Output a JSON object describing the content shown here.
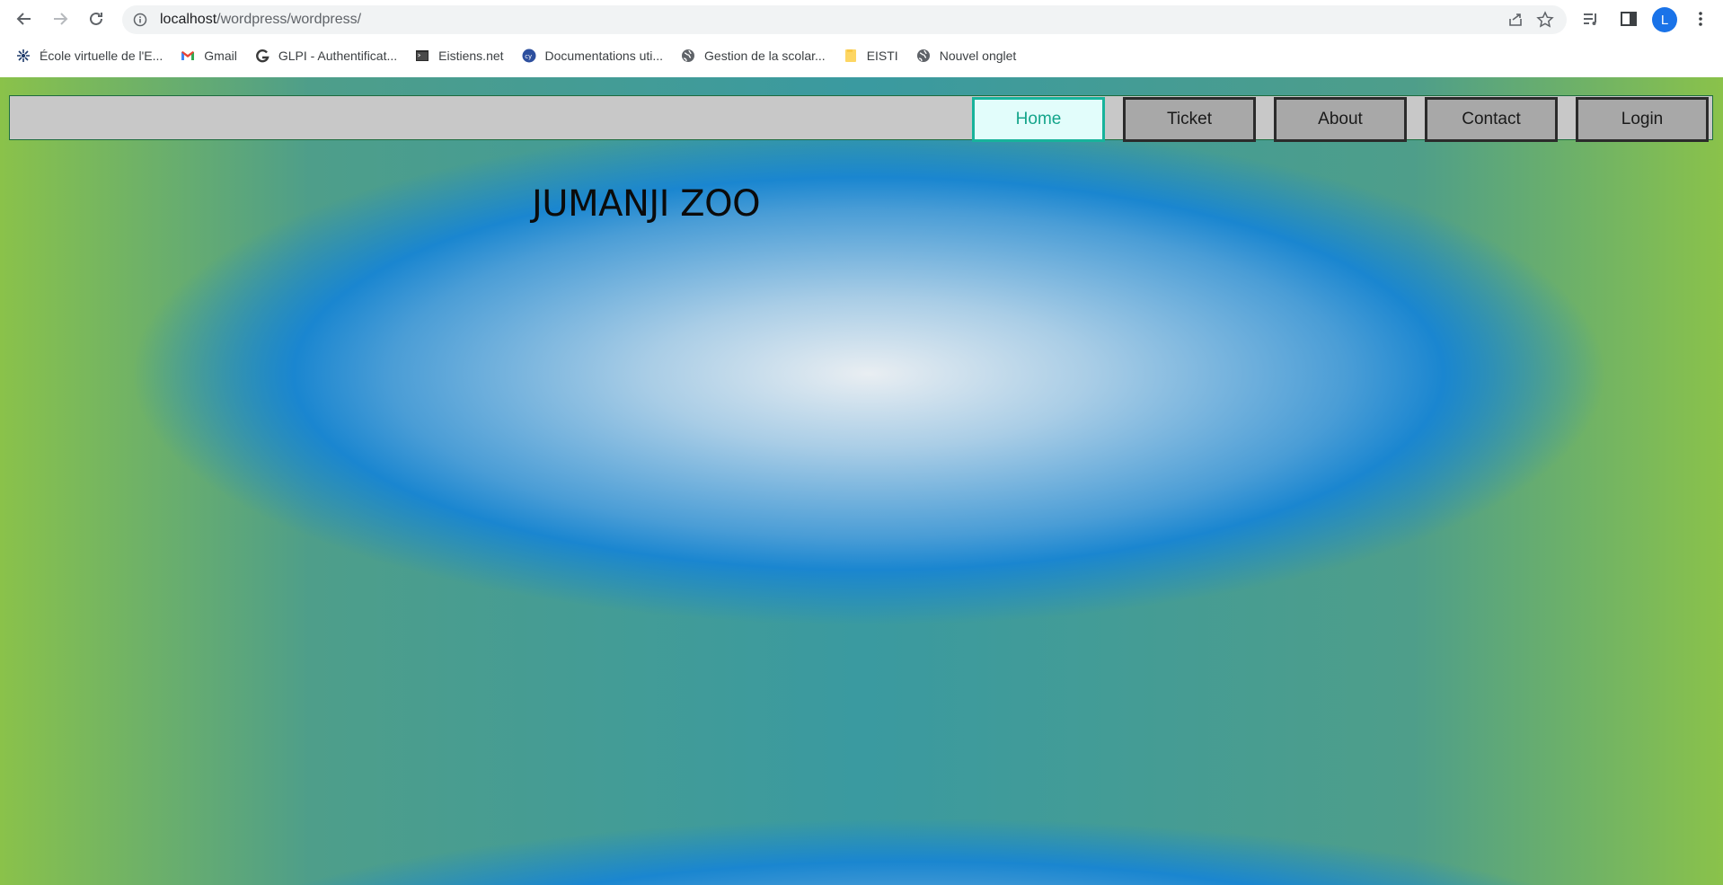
{
  "browser": {
    "url_host": "localhost",
    "url_path": "/wordpress/wordpress/",
    "profile_initial": "L",
    "bookmarks": [
      {
        "label": "École virtuelle de l'E...",
        "icon": "moodle-icon"
      },
      {
        "label": "Gmail",
        "icon": "gmail-icon"
      },
      {
        "label": "GLPI - Authentificat...",
        "icon": "glpi-icon"
      },
      {
        "label": "Eistiens.net",
        "icon": "terminal-icon"
      },
      {
        "label": "Documentations uti...",
        "icon": "cy-icon"
      },
      {
        "label": "Gestion de la scolar...",
        "icon": "globe-icon"
      },
      {
        "label": "EISTI",
        "icon": "folder-icon"
      },
      {
        "label": "Nouvel onglet",
        "icon": "globe-icon"
      }
    ]
  },
  "site": {
    "title": "JUMANJI ZOO",
    "menu": [
      {
        "label": "Home",
        "active": true
      },
      {
        "label": "Ticket",
        "active": false
      },
      {
        "label": "About",
        "active": false
      },
      {
        "label": "Contact",
        "active": false
      },
      {
        "label": "Login",
        "active": false
      }
    ],
    "colors": {
      "nav_bg": "#c8c8c8",
      "menu_bg": "#a8a8a8",
      "active_bg": "#e2fdfb",
      "active_border": "#17b39b",
      "active_text": "#14a58b",
      "background_blue": "#1a86d0",
      "background_green": "#8ac24a"
    }
  }
}
